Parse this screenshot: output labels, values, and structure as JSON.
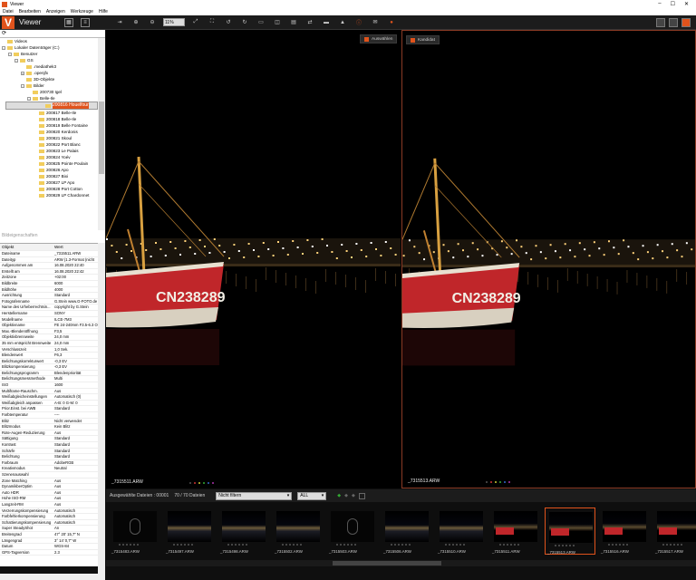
{
  "window": {
    "title": "Viewer"
  },
  "menu": [
    "Datei",
    "Bearbeiten",
    "Anzeigen",
    "Werkzeuge",
    "Hilfe"
  ],
  "toolbar": {
    "app_name": "Viewer",
    "zoom": "11%",
    "brand_letter": "V"
  },
  "tree": {
    "items": [
      {
        "label": "Videos",
        "level": 0,
        "pm": ""
      },
      {
        "label": "Lokaler Datenträger (C:)",
        "level": 0,
        "pm": "-"
      },
      {
        "label": "Benutzer",
        "level": 1,
        "pm": "-"
      },
      {
        "label": "GS",
        "level": 2,
        "pm": "-"
      },
      {
        "label": ".mediathek3",
        "level": 3,
        "pm": ""
      },
      {
        "label": ".openjfx",
        "level": 3,
        "pm": "+"
      },
      {
        "label": "3D-Objekte",
        "level": 3,
        "pm": ""
      },
      {
        "label": "Bilder",
        "level": 3,
        "pm": "-"
      },
      {
        "label": "200730 Igel",
        "level": 4,
        "pm": ""
      },
      {
        "label": "Belle-Ile",
        "level": 4,
        "pm": "-"
      },
      {
        "label": "200816 Houelfour",
        "level": 5,
        "pm": "",
        "selected": true
      },
      {
        "label": "200817 Belle-Ile",
        "level": 5,
        "pm": ""
      },
      {
        "label": "200818 Belle-Ile",
        "level": 5,
        "pm": ""
      },
      {
        "label": "200819 Belle Fontaine",
        "level": 5,
        "pm": ""
      },
      {
        "label": "200820 Kerdonis",
        "level": 5,
        "pm": ""
      },
      {
        "label": "200821 Skoul",
        "level": 5,
        "pm": ""
      },
      {
        "label": "200822 Port Blanc",
        "level": 5,
        "pm": ""
      },
      {
        "label": "200823 Le Palais",
        "level": 5,
        "pm": ""
      },
      {
        "label": "200824 Yoév",
        "level": 5,
        "pm": ""
      },
      {
        "label": "200825 Pointe Poulain",
        "level": 5,
        "pm": ""
      },
      {
        "label": "200826 Apo",
        "level": 5,
        "pm": ""
      },
      {
        "label": "200827 Bixi",
        "level": 5,
        "pm": ""
      },
      {
        "label": "200827 LP Apo",
        "level": 5,
        "pm": ""
      },
      {
        "label": "200828 Port Cotton",
        "level": 5,
        "pm": ""
      },
      {
        "label": "200829 LP Chardonnet",
        "level": 5,
        "pm": ""
      }
    ]
  },
  "props": {
    "section_title": "Bildeigenschaften",
    "col_object": "Objekt",
    "col_value": "Wert",
    "rows": [
      [
        "Dateiname",
        "_7315511.ARW"
      ],
      [
        "Dateityp",
        "ARW (1.3-Format (nicht"
      ],
      [
        "Aufgenommen am",
        "16.08.2020 22:40"
      ],
      [
        "Erstellt am",
        "16.08.2020 22:42"
      ],
      [
        "Zeitzone",
        "+02:00"
      ],
      [
        "Bildbreite",
        "6000"
      ],
      [
        "Bildhöhe",
        "4000"
      ],
      [
        "Ausrichtung",
        "Standard"
      ],
      [
        "Fotografenname",
        "G.Stein www.G-FOTO.de"
      ],
      [
        "Name des Urheberrechtsin...",
        "copyright by G.Stein"
      ],
      [
        "Herstellername",
        "SONY"
      ],
      [
        "Modellname",
        "ILCE-7M3"
      ],
      [
        "Objektivname",
        "FE 24-240mm F3.5-6.3 OSS"
      ],
      [
        "Max.-Blendenöffnung",
        "F3,5"
      ],
      [
        "Objektivbrennweite",
        "24,0 mm"
      ],
      [
        "35 mm entspricht Brennweite",
        "24,0 mm"
      ],
      [
        "Verschlusszeit",
        "1,0 Sek."
      ],
      [
        "Blendenwert",
        "F6,3"
      ],
      [
        "Belichtungskorrekturwert",
        "-0,3 EV"
      ],
      [
        "Blitzkompensierung",
        "-0,3 EV"
      ],
      [
        "Belichtungsprogramm",
        "Blendenpriorität"
      ],
      [
        "Belichtungsmessmethode",
        "Multi"
      ],
      [
        "ISO",
        "1600"
      ],
      [
        "Multiframe-Rauschm.",
        "Aus"
      ],
      [
        "Weißabgleicheinstellungen",
        "Automatisch (0)"
      ],
      [
        "Weißabgleich anpassen",
        "A-B: 0 G-M: 0"
      ],
      [
        "Prior.Einst. bei AWB",
        "Standard"
      ],
      [
        "Farbtemperatur",
        "----"
      ],
      [
        "Blitz",
        "Nicht verwendet"
      ],
      [
        "Blitzmodus",
        "Kein Blitz"
      ],
      [
        "Rote-Augen-Reduzierung",
        "Aus"
      ],
      [
        "Sättigung",
        "Standard"
      ],
      [
        "Kontrast",
        "Standard"
      ],
      [
        "Schärfe",
        "Standard"
      ],
      [
        "Belichtung",
        "Standard"
      ],
      [
        "Farbraum",
        "AdobeRGB"
      ],
      [
        "Kreativmodus",
        "Neutral"
      ],
      [
        "Szenenauswahl",
        ""
      ],
      [
        "Zone Matching",
        "Aus"
      ],
      [
        "DynamikberOptim",
        "Aus"
      ],
      [
        "Auto HDR",
        "Aus"
      ],
      [
        "Hohe ISO-RM",
        "Aus"
      ],
      [
        "Langzeit-RM",
        "Aus"
      ],
      [
        "Verzerrungskompensierung",
        "Automatisch"
      ],
      [
        "Farbfehlerkompensierung",
        "Automatisch"
      ],
      [
        "Schattierungskompensierung",
        "Automatisch"
      ],
      [
        "Super SteadyShot",
        "An"
      ],
      [
        "Breitengrad",
        "47° 20' 15,7\" N"
      ],
      [
        "Längengrad",
        "3° 14' 0,7\" W"
      ],
      [
        "Datum",
        "WGS-84"
      ],
      [
        "GPS-Tagversion",
        "2.3"
      ]
    ]
  },
  "viewer": {
    "a": {
      "button": "Auswählen",
      "filename": "_7315511.ARW"
    },
    "b": {
      "button": "Kandidat",
      "filename": "_7315513.ARW"
    }
  },
  "status": {
    "selected": "Ausgewählte Dateien : 00001",
    "count": "70 / 70 Dateien",
    "filter": "Nicht filtern",
    "all": "ALL"
  },
  "filmstrip": [
    {
      "name": "_7315483.ARW",
      "kind": "dark"
    },
    {
      "name": "_7315497.ARW",
      "kind": "night"
    },
    {
      "name": "_7315498.ARW",
      "kind": "night"
    },
    {
      "name": "_7315502.ARW",
      "kind": "night"
    },
    {
      "name": "_7315503.ARW",
      "kind": "dark"
    },
    {
      "name": "_7315506.ARW",
      "kind": "night"
    },
    {
      "name": "_7315510.ARW",
      "kind": "night"
    },
    {
      "name": "_7315511.ARW",
      "kind": "boat"
    },
    {
      "name": "_7315513.ARW",
      "kind": "boat",
      "selected": true
    },
    {
      "name": "_7315516.ARW",
      "kind": "boat"
    },
    {
      "name": "_7315517.ARW",
      "kind": "boat"
    }
  ],
  "boat": {
    "hull_text": "CN238289"
  },
  "colors": {
    "accent": "#e0531c",
    "hull": "#c0262a"
  }
}
